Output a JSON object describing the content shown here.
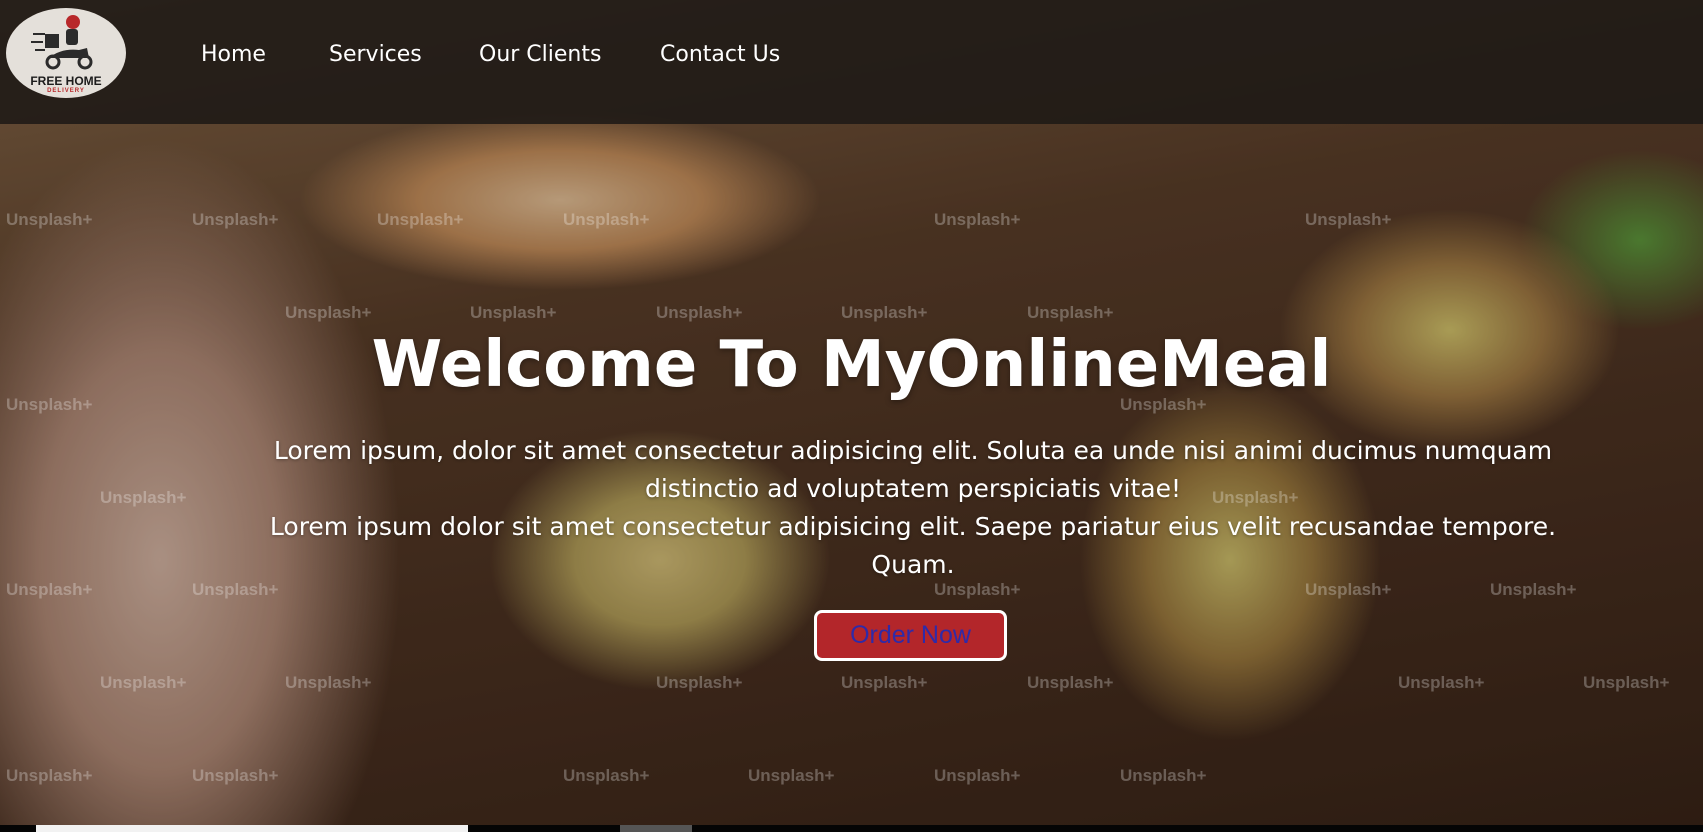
{
  "logo": {
    "title": "FREE HOME",
    "subtitle": "DELIVERY",
    "icon": "scooter-delivery-icon"
  },
  "nav": {
    "items": [
      {
        "label": "Home"
      },
      {
        "label": "Services"
      },
      {
        "label": "Our Clients"
      },
      {
        "label": "Contact Us"
      }
    ]
  },
  "hero": {
    "title": "Welcome To MyOnlineMeal",
    "paragraph_1": "Lorem ipsum, dolor sit amet consectetur adipisicing elit. Soluta ea unde nisi animi ducimus numquam distinctio ad voluptatem perspiciatis vitae!",
    "paragraph_2": "Lorem ipsum dolor sit amet consectetur adipisicing elit. Saepe pariatur eius velit recusandae tempore. Quam.",
    "button_label": "Order Now",
    "watermark_text": "Unsplash+"
  },
  "colors": {
    "button_bg": "#b3262a",
    "button_text": "#2f2aa8",
    "navbar_bg": "#1e1916"
  }
}
